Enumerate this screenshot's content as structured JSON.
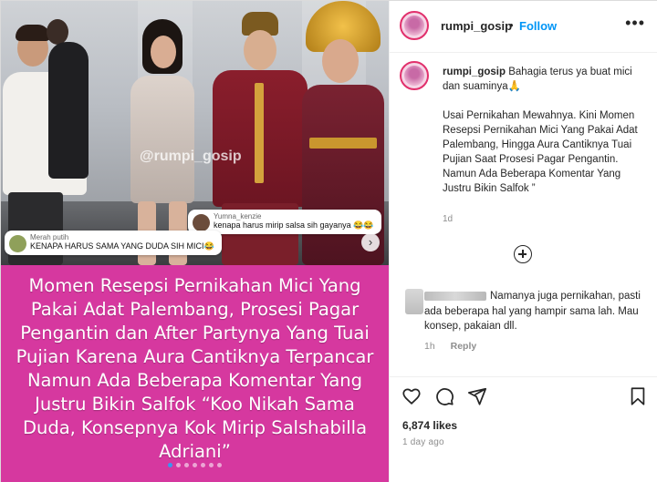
{
  "media": {
    "watermark": "@rumpi_gosip",
    "overlay_comments": [
      {
        "name": "Merah putih",
        "text": "KENAPA HARUS SAMA YANG DUDA SIH MICI😂"
      },
      {
        "name": "Yumna_kenzie",
        "text": "kenapa harus mirip salsa sih gayanya 😂😂"
      }
    ],
    "headline": "Momen Resepsi Pernikahan Mici Yang Pakai Adat Palembang, Prosesi Pagar Pengantin dan After Partynya Yang Tuai Pujian Karena Aura Cantiknya Terpancar Namun Ada Beberapa Komentar Yang Justru Bikin Salfok “Koo Nikah Sama Duda, Konsepnya Kok Mirip Salshabilla Adriani”",
    "next_arrow": "›",
    "carousel_dots": 7,
    "active_dot": 0
  },
  "header": {
    "username": "rumpi_gosip",
    "separator": "•",
    "follow_label": "Follow",
    "more": "•••"
  },
  "caption": {
    "username": "rumpi_gosip",
    "first_line": " Bahagia terus ya buat mici dan suaminya🙏",
    "body": "Usai Pernikahan Mewahnya. Kini Momen Resepsi Pernikahan Mici Yang Pakai Adat Palembang, Hingga Aura Cantiknya Tuai Pujian Saat Prosesi Pagar Pengantin. Namun Ada Beberapa Komentar Yang Justru Bikin Salfok ”",
    "time": "1d"
  },
  "comment": {
    "text": "Namanya juga pernikahan, pasti ada beberapa hal yang hampir sama lah. Mau konsep, pakaian dll.",
    "time": "1h",
    "reply_label": "Reply"
  },
  "footer": {
    "likes": "6,874 likes",
    "posted": "1 day ago"
  },
  "colors": {
    "media_bg": "#d6389f",
    "follow": "#0095f6"
  }
}
